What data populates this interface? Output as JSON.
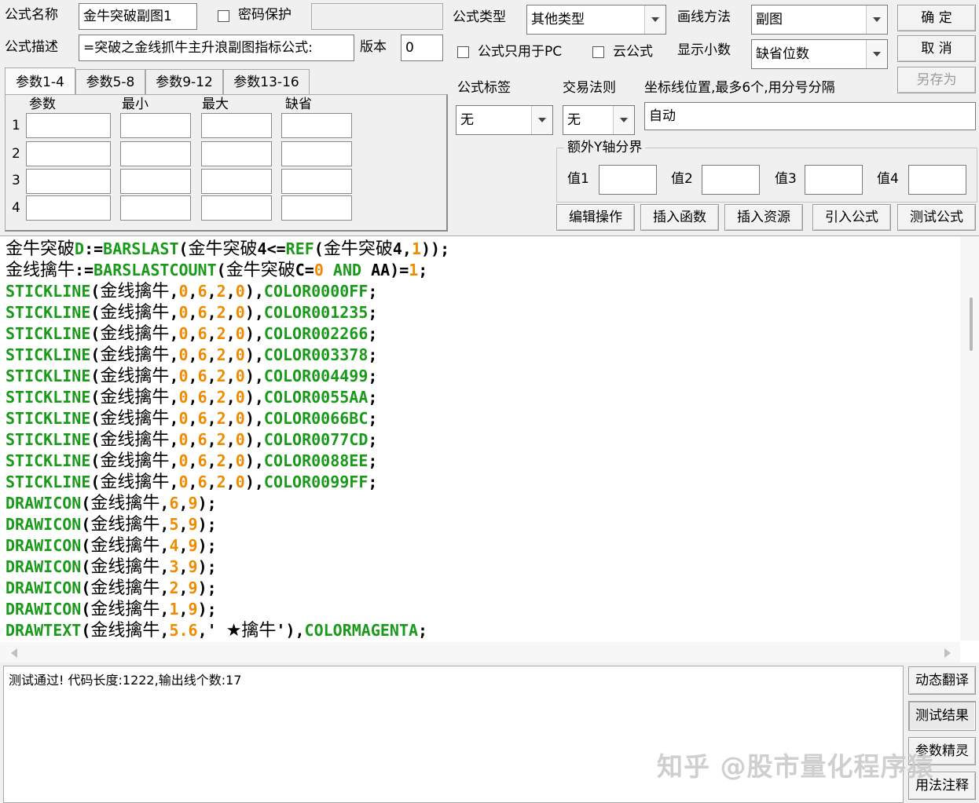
{
  "form": {
    "name_label": "公式名称",
    "name_value": "金牛突破副图1",
    "password_label": "密码保护",
    "desc_label": "公式描述",
    "desc_value": "=突破之金线抓牛主升浪副图指标公式:",
    "version_label": "版本",
    "version_value": "0",
    "type_label": "公式类型",
    "type_value": "其他类型",
    "draw_label": "画线方法",
    "draw_value": "副图",
    "pc_only_label": "公式只用于PC",
    "cloud_label": "云公式",
    "decimal_label": "显示小数",
    "decimal_value": "缺省位数",
    "tag_label": "公式标签",
    "tag_value": "无",
    "trade_label": "交易法则",
    "trade_value": "无",
    "axis_label": "坐标线位置,最多6个,用分号分隔",
    "axis_value": "自动",
    "ybound_label": "额外Y轴分界",
    "ybound_v1": "值1",
    "ybound_v2": "值2",
    "ybound_v3": "值3",
    "ybound_v4": "值4"
  },
  "buttons": {
    "ok": "确 定",
    "cancel": "取 消",
    "save_as": "另存为",
    "edit_ops": "编辑操作",
    "insert_func": "插入函数",
    "insert_res": "插入资源",
    "import_formula": "引入公式",
    "test_formula": "测试公式",
    "dyn_translate": "动态翻译",
    "test_result": "测试结果",
    "param_wizard": "参数精灵",
    "usage_notes": "用法注释"
  },
  "tabs": [
    "参数1-4",
    "参数5-8",
    "参数9-12",
    "参数13-16"
  ],
  "params": {
    "headers": [
      "参数",
      "最小",
      "最大",
      "缺省"
    ],
    "rows": [
      "1",
      "2",
      "3",
      "4"
    ]
  },
  "code": [
    [
      [
        "v",
        "金牛突破"
      ],
      [
        "f",
        "D"
      ],
      [
        "p",
        ":="
      ],
      [
        "f",
        "BARSLAST"
      ],
      [
        "p",
        "("
      ],
      [
        "v",
        "金牛突破"
      ],
      [
        "p",
        "4<="
      ],
      [
        "f",
        "REF"
      ],
      [
        "p",
        "("
      ],
      [
        "v",
        "金牛突破"
      ],
      [
        "p",
        "4,"
      ],
      [
        "n",
        "1"
      ],
      [
        "p",
        "));"
      ]
    ],
    [
      [
        "v",
        "金线擒牛"
      ],
      [
        "p",
        ":="
      ],
      [
        "f",
        "BARSLASTCOUNT"
      ],
      [
        "p",
        "("
      ],
      [
        "v",
        "金牛突破"
      ],
      [
        "p",
        "C="
      ],
      [
        "n",
        "0"
      ],
      [
        "p",
        " "
      ],
      [
        "f",
        "AND"
      ],
      [
        "p",
        " AA)="
      ],
      [
        "n",
        "1"
      ],
      [
        "p",
        ";"
      ]
    ],
    [
      [
        "f",
        "STICKLINE"
      ],
      [
        "p",
        "("
      ],
      [
        "v",
        "金线擒牛"
      ],
      [
        "p",
        ","
      ],
      [
        "n",
        "0"
      ],
      [
        "p",
        ","
      ],
      [
        "n",
        "6"
      ],
      [
        "p",
        ","
      ],
      [
        "n",
        "2"
      ],
      [
        "p",
        ","
      ],
      [
        "n",
        "0"
      ],
      [
        "p",
        "),"
      ],
      [
        "f",
        "COLOR0000FF"
      ],
      [
        "p",
        ";"
      ]
    ],
    [
      [
        "f",
        "STICKLINE"
      ],
      [
        "p",
        "("
      ],
      [
        "v",
        "金线擒牛"
      ],
      [
        "p",
        ","
      ],
      [
        "n",
        "0"
      ],
      [
        "p",
        ","
      ],
      [
        "n",
        "6"
      ],
      [
        "p",
        ","
      ],
      [
        "n",
        "2"
      ],
      [
        "p",
        ","
      ],
      [
        "n",
        "0"
      ],
      [
        "p",
        "),"
      ],
      [
        "f",
        "COLOR001235"
      ],
      [
        "p",
        ";"
      ]
    ],
    [
      [
        "f",
        "STICKLINE"
      ],
      [
        "p",
        "("
      ],
      [
        "v",
        "金线擒牛"
      ],
      [
        "p",
        ","
      ],
      [
        "n",
        "0"
      ],
      [
        "p",
        ","
      ],
      [
        "n",
        "6"
      ],
      [
        "p",
        ","
      ],
      [
        "n",
        "2"
      ],
      [
        "p",
        ","
      ],
      [
        "n",
        "0"
      ],
      [
        "p",
        "),"
      ],
      [
        "f",
        "COLOR002266"
      ],
      [
        "p",
        ";"
      ]
    ],
    [
      [
        "f",
        "STICKLINE"
      ],
      [
        "p",
        "("
      ],
      [
        "v",
        "金线擒牛"
      ],
      [
        "p",
        ","
      ],
      [
        "n",
        "0"
      ],
      [
        "p",
        ","
      ],
      [
        "n",
        "6"
      ],
      [
        "p",
        ","
      ],
      [
        "n",
        "2"
      ],
      [
        "p",
        ","
      ],
      [
        "n",
        "0"
      ],
      [
        "p",
        "),"
      ],
      [
        "f",
        "COLOR003378"
      ],
      [
        "p",
        ";"
      ]
    ],
    [
      [
        "f",
        "STICKLINE"
      ],
      [
        "p",
        "("
      ],
      [
        "v",
        "金线擒牛"
      ],
      [
        "p",
        ","
      ],
      [
        "n",
        "0"
      ],
      [
        "p",
        ","
      ],
      [
        "n",
        "6"
      ],
      [
        "p",
        ","
      ],
      [
        "n",
        "2"
      ],
      [
        "p",
        ","
      ],
      [
        "n",
        "0"
      ],
      [
        "p",
        "),"
      ],
      [
        "f",
        "COLOR004499"
      ],
      [
        "p",
        ";"
      ]
    ],
    [
      [
        "f",
        "STICKLINE"
      ],
      [
        "p",
        "("
      ],
      [
        "v",
        "金线擒牛"
      ],
      [
        "p",
        ","
      ],
      [
        "n",
        "0"
      ],
      [
        "p",
        ","
      ],
      [
        "n",
        "6"
      ],
      [
        "p",
        ","
      ],
      [
        "n",
        "2"
      ],
      [
        "p",
        ","
      ],
      [
        "n",
        "0"
      ],
      [
        "p",
        "),"
      ],
      [
        "f",
        "COLOR0055AA"
      ],
      [
        "p",
        ";"
      ]
    ],
    [
      [
        "f",
        "STICKLINE"
      ],
      [
        "p",
        "("
      ],
      [
        "v",
        "金线擒牛"
      ],
      [
        "p",
        ","
      ],
      [
        "n",
        "0"
      ],
      [
        "p",
        ","
      ],
      [
        "n",
        "6"
      ],
      [
        "p",
        ","
      ],
      [
        "n",
        "2"
      ],
      [
        "p",
        ","
      ],
      [
        "n",
        "0"
      ],
      [
        "p",
        "),"
      ],
      [
        "f",
        "COLOR0066BC"
      ],
      [
        "p",
        ";"
      ]
    ],
    [
      [
        "f",
        "STICKLINE"
      ],
      [
        "p",
        "("
      ],
      [
        "v",
        "金线擒牛"
      ],
      [
        "p",
        ","
      ],
      [
        "n",
        "0"
      ],
      [
        "p",
        ","
      ],
      [
        "n",
        "6"
      ],
      [
        "p",
        ","
      ],
      [
        "n",
        "2"
      ],
      [
        "p",
        ","
      ],
      [
        "n",
        "0"
      ],
      [
        "p",
        "),"
      ],
      [
        "f",
        "COLOR0077CD"
      ],
      [
        "p",
        ";"
      ]
    ],
    [
      [
        "f",
        "STICKLINE"
      ],
      [
        "p",
        "("
      ],
      [
        "v",
        "金线擒牛"
      ],
      [
        "p",
        ","
      ],
      [
        "n",
        "0"
      ],
      [
        "p",
        ","
      ],
      [
        "n",
        "6"
      ],
      [
        "p",
        ","
      ],
      [
        "n",
        "2"
      ],
      [
        "p",
        ","
      ],
      [
        "n",
        "0"
      ],
      [
        "p",
        "),"
      ],
      [
        "f",
        "COLOR0088EE"
      ],
      [
        "p",
        ";"
      ]
    ],
    [
      [
        "f",
        "STICKLINE"
      ],
      [
        "p",
        "("
      ],
      [
        "v",
        "金线擒牛"
      ],
      [
        "p",
        ","
      ],
      [
        "n",
        "0"
      ],
      [
        "p",
        ","
      ],
      [
        "n",
        "6"
      ],
      [
        "p",
        ","
      ],
      [
        "n",
        "2"
      ],
      [
        "p",
        ","
      ],
      [
        "n",
        "0"
      ],
      [
        "p",
        "),"
      ],
      [
        "f",
        "COLOR0099FF"
      ],
      [
        "p",
        ";"
      ]
    ],
    [
      [
        "f",
        "DRAWICON"
      ],
      [
        "p",
        "("
      ],
      [
        "v",
        "金线擒牛"
      ],
      [
        "p",
        ","
      ],
      [
        "n",
        "6"
      ],
      [
        "p",
        ","
      ],
      [
        "n",
        "9"
      ],
      [
        "p",
        ");"
      ]
    ],
    [
      [
        "f",
        "DRAWICON"
      ],
      [
        "p",
        "("
      ],
      [
        "v",
        "金线擒牛"
      ],
      [
        "p",
        ","
      ],
      [
        "n",
        "5"
      ],
      [
        "p",
        ","
      ],
      [
        "n",
        "9"
      ],
      [
        "p",
        ");"
      ]
    ],
    [
      [
        "f",
        "DRAWICON"
      ],
      [
        "p",
        "("
      ],
      [
        "v",
        "金线擒牛"
      ],
      [
        "p",
        ","
      ],
      [
        "n",
        "4"
      ],
      [
        "p",
        ","
      ],
      [
        "n",
        "9"
      ],
      [
        "p",
        ");"
      ]
    ],
    [
      [
        "f",
        "DRAWICON"
      ],
      [
        "p",
        "("
      ],
      [
        "v",
        "金线擒牛"
      ],
      [
        "p",
        ","
      ],
      [
        "n",
        "3"
      ],
      [
        "p",
        ","
      ],
      [
        "n",
        "9"
      ],
      [
        "p",
        ");"
      ]
    ],
    [
      [
        "f",
        "DRAWICON"
      ],
      [
        "p",
        "("
      ],
      [
        "v",
        "金线擒牛"
      ],
      [
        "p",
        ","
      ],
      [
        "n",
        "2"
      ],
      [
        "p",
        ","
      ],
      [
        "n",
        "9"
      ],
      [
        "p",
        ");"
      ]
    ],
    [
      [
        "f",
        "DRAWICON"
      ],
      [
        "p",
        "("
      ],
      [
        "v",
        "金线擒牛"
      ],
      [
        "p",
        ","
      ],
      [
        "n",
        "1"
      ],
      [
        "p",
        ","
      ],
      [
        "n",
        "9"
      ],
      [
        "p",
        ");"
      ]
    ],
    [
      [
        "f",
        "DRAWTEXT"
      ],
      [
        "p",
        "("
      ],
      [
        "v",
        "金线擒牛"
      ],
      [
        "p",
        ","
      ],
      [
        "n",
        "5.6"
      ],
      [
        "p",
        ",' "
      ],
      [
        "v",
        "★擒牛"
      ],
      [
        "p",
        "'),"
      ],
      [
        "f",
        "COLORMAGENTA"
      ],
      [
        "p",
        ";"
      ]
    ]
  ],
  "status": "测试通过! 代码长度:1222,输出线个数:17",
  "watermark": "知乎 @股市量化程序猿",
  "colors": {
    "func": "#1a9a1a",
    "number": "#f08a00",
    "text": "#000000"
  }
}
